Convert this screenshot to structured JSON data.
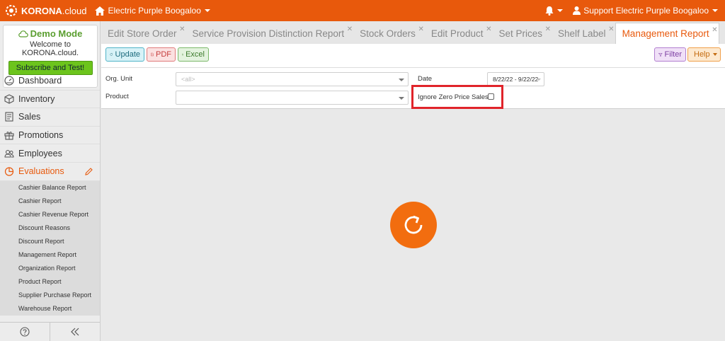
{
  "brand": {
    "name": "KORONA",
    "suffix": ".cloud"
  },
  "header": {
    "store": "Electric Purple Boogaloo",
    "user": "Support Electric Purple Boogaloo"
  },
  "demo": {
    "title": "Demo Mode",
    "subtitle": "Welcome to KORONA.cloud.",
    "button": "Subscribe and Test!"
  },
  "nav": {
    "items": [
      {
        "label": "Dashboard",
        "icon": "dashboard-icon"
      },
      {
        "label": "Inventory",
        "icon": "inventory-icon"
      },
      {
        "label": "Sales",
        "icon": "sales-icon"
      },
      {
        "label": "Promotions",
        "icon": "gift-icon"
      },
      {
        "label": "Employees",
        "icon": "employees-icon"
      },
      {
        "label": "Evaluations",
        "icon": "pie-chart-icon"
      }
    ],
    "subitems": [
      "Cashier Balance Report",
      "Cashier Report",
      "Cashier Revenue Report",
      "Discount Reasons",
      "Discount Report",
      "Management Report",
      "Organization Report",
      "Product Report",
      "Supplier Purchase Report",
      "Warehouse Report"
    ]
  },
  "tabs": [
    {
      "label": "Edit Store Order",
      "active": false
    },
    {
      "label": "Service Provision Distinction Report",
      "active": false
    },
    {
      "label": "Stock Orders",
      "active": false
    },
    {
      "label": "Edit Product",
      "active": false
    },
    {
      "label": "Set Prices",
      "active": false
    },
    {
      "label": "Shelf Label",
      "active": false
    },
    {
      "label": "Management Report",
      "active": true
    }
  ],
  "toolbar": {
    "update": "Update",
    "pdf": "PDF",
    "excel": "Excel",
    "filter": "Filter",
    "help": "Help"
  },
  "form": {
    "org_unit_label": "Org. Unit",
    "org_unit_value": "<all>",
    "product_label": "Product",
    "product_value": "",
    "date_label": "Date",
    "date_value": "8/22/22 - 9/22/22",
    "ignore_zero_label": "Ignore Zero Price Sales",
    "ignore_zero_checked": false
  },
  "colors": {
    "accent": "#e8590c",
    "highlight": "#e0242a",
    "demo_green": "#6cc41c"
  }
}
